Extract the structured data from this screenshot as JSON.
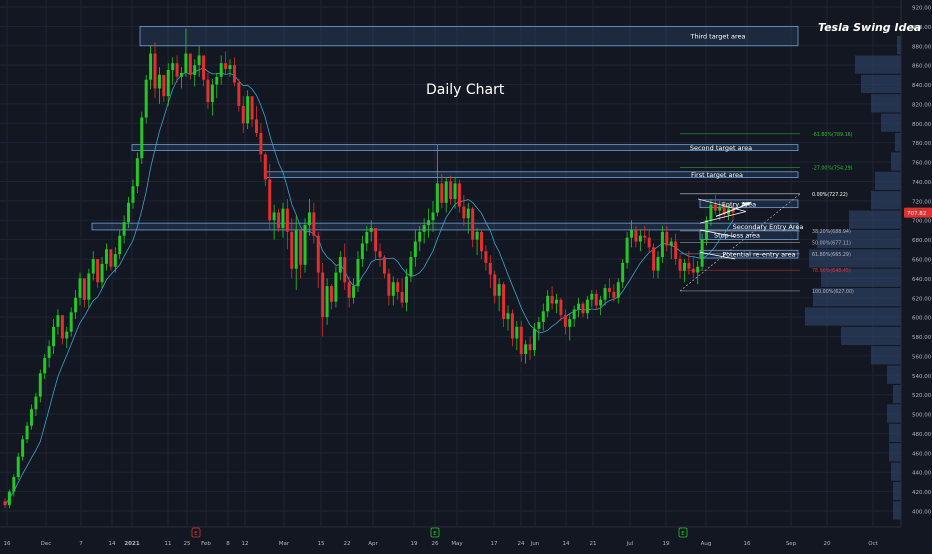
{
  "page": {
    "title": "Tesla Swing Idea",
    "subtitle": "Daily Chart",
    "last_price": "707.82",
    "colors": {
      "bg": "#131722",
      "up": "#26c626",
      "down": "#e03030",
      "ma": "#3ba4c9",
      "zone": "#4d7fb5",
      "grid": "#1f2433",
      "axis_text": "#b2b5be"
    }
  },
  "chart_data": {
    "type": "candlestick",
    "title": "Tesla Swing Idea",
    "subtitle": "Daily Chart",
    "ylim": [
      393,
      928
    ],
    "x_ticks": [
      "16",
      "Dec",
      "7",
      "14",
      "2021",
      "11",
      "25",
      "Feb",
      "8",
      "12",
      "Mar",
      "15",
      "22",
      "Apr",
      "19",
      "26",
      "May",
      "17",
      "24",
      "Jun",
      "14",
      "21",
      "Jul",
      "19",
      "Aug",
      "16",
      "Sep",
      "20",
      "Oct"
    ],
    "y_ticks": [
      920,
      900,
      880,
      860,
      840,
      820,
      800,
      780,
      760,
      740,
      720,
      700,
      680,
      660,
      640,
      620,
      600,
      580,
      560,
      540,
      520,
      500,
      480,
      460,
      440,
      420,
      400
    ],
    "last_price": 707.82,
    "zones": [
      {
        "label": "Third target area",
        "low": 880,
        "high": 900
      },
      {
        "label": "Second target area",
        "low": 772,
        "high": 778
      },
      {
        "label": "First target area",
        "low": 744,
        "high": 750
      },
      {
        "label": "Entry Area",
        "low": 713,
        "high": 721
      },
      {
        "label": "Secondary Entry Area",
        "low": 690,
        "high": 697
      },
      {
        "label": "Stop loss area",
        "low": 680,
        "high": 690
      },
      {
        "label": "Potential re-entry area",
        "low": 661,
        "high": 669
      }
    ],
    "fib_levels": [
      {
        "label": "-61.80%(789.16)",
        "value": 789.16,
        "color": "#26c626"
      },
      {
        "label": "-27.00%(754.29)",
        "value": 754.29,
        "color": "#26c626"
      },
      {
        "label": "0.00%(727.22)",
        "value": 727.22,
        "color": "#ffffff"
      },
      {
        "label": "38.20%(688.94)",
        "value": 688.94,
        "color": "#b2b5be"
      },
      {
        "label": "50.00%(677.11)",
        "value": 677.11,
        "color": "#b2b5be"
      },
      {
        "label": "61.80%(665.29)",
        "value": 665.29,
        "color": "#b2b5be"
      },
      {
        "label": "78.60%(648.45)",
        "value": 648.45,
        "color": "#e03030"
      },
      {
        "label": "100.00%(627.00)",
        "value": 627.0,
        "color": "#b2b5be"
      }
    ],
    "earnings_markers": [
      "E",
      "E",
      "E"
    ],
    "candles": [
      [
        410,
        413,
        403,
        406
      ],
      [
        406,
        422,
        403,
        420
      ],
      [
        420,
        438,
        415,
        435
      ],
      [
        435,
        460,
        432,
        456
      ],
      [
        456,
        478,
        452,
        474
      ],
      [
        474,
        492,
        470,
        488
      ],
      [
        488,
        510,
        484,
        505
      ],
      [
        505,
        522,
        498,
        518
      ],
      [
        518,
        546,
        512,
        542
      ],
      [
        542,
        562,
        536,
        558
      ],
      [
        558,
        576,
        548,
        570
      ],
      [
        570,
        598,
        562,
        590
      ],
      [
        590,
        608,
        582,
        602
      ],
      [
        602,
        596,
        572,
        578
      ],
      [
        578,
        590,
        568,
        585
      ],
      [
        585,
        610,
        580,
        605
      ],
      [
        605,
        628,
        598,
        620
      ],
      [
        620,
        646,
        612,
        640
      ],
      [
        640,
        632,
        610,
        618
      ],
      [
        618,
        650,
        610,
        645
      ],
      [
        645,
        668,
        638,
        660
      ],
      [
        660,
        652,
        630,
        636
      ],
      [
        636,
        662,
        630,
        655
      ],
      [
        655,
        676,
        648,
        670
      ],
      [
        670,
        664,
        648,
        652
      ],
      [
        652,
        672,
        646,
        665
      ],
      [
        665,
        690,
        660,
        684
      ],
      [
        684,
        705,
        676,
        698
      ],
      [
        698,
        724,
        692,
        718
      ],
      [
        718,
        742,
        712,
        735
      ],
      [
        735,
        770,
        728,
        764
      ],
      [
        764,
        812,
        758,
        806
      ],
      [
        806,
        850,
        800,
        845
      ],
      [
        845,
        880,
        835,
        872
      ],
      [
        872,
        884,
        826,
        836
      ],
      [
        836,
        858,
        820,
        850
      ],
      [
        850,
        846,
        822,
        828
      ],
      [
        828,
        862,
        818,
        855
      ],
      [
        855,
        868,
        840,
        862
      ],
      [
        862,
        870,
        842,
        848
      ],
      [
        848,
        858,
        836,
        852
      ],
      [
        852,
        898,
        848,
        872
      ],
      [
        872,
        868,
        845,
        850
      ],
      [
        850,
        866,
        838,
        860
      ],
      [
        860,
        880,
        848,
        870
      ],
      [
        870,
        860,
        838,
        845
      ],
      [
        845,
        852,
        815,
        822
      ],
      [
        822,
        846,
        808,
        840
      ],
      [
        840,
        852,
        826,
        848
      ],
      [
        848,
        870,
        840,
        862
      ],
      [
        862,
        874,
        850,
        856
      ],
      [
        856,
        866,
        848,
        860
      ],
      [
        860,
        868,
        838,
        842
      ],
      [
        842,
        846,
        812,
        818
      ],
      [
        818,
        828,
        790,
        800
      ],
      [
        800,
        834,
        794,
        828
      ],
      [
        828,
        822,
        796,
        804
      ],
      [
        804,
        818,
        786,
        790
      ],
      [
        790,
        800,
        760,
        768
      ],
      [
        768,
        770,
        735,
        742
      ],
      [
        742,
        758,
        690,
        700
      ],
      [
        700,
        716,
        680,
        708
      ],
      [
        708,
        712,
        688,
        692
      ],
      [
        692,
        718,
        682,
        712
      ],
      [
        712,
        722,
        670,
        688
      ],
      [
        688,
        702,
        640,
        650
      ],
      [
        650,
        704,
        628,
        690
      ],
      [
        690,
        684,
        640,
        654
      ],
      [
        654,
        702,
        646,
        695
      ],
      [
        695,
        722,
        684,
        708
      ],
      [
        708,
        718,
        676,
        684
      ],
      [
        684,
        688,
        630,
        646
      ],
      [
        646,
        656,
        580,
        600
      ],
      [
        600,
        640,
        592,
        632
      ],
      [
        632,
        634,
        608,
        616
      ],
      [
        616,
        652,
        610,
        646
      ],
      [
        646,
        668,
        638,
        662
      ],
      [
        662,
        676,
        628,
        636
      ],
      [
        636,
        642,
        610,
        620
      ],
      [
        620,
        640,
        614,
        632
      ],
      [
        632,
        668,
        626,
        660
      ],
      [
        660,
        684,
        652,
        676
      ],
      [
        676,
        694,
        668,
        688
      ],
      [
        688,
        700,
        678,
        692
      ],
      [
        692,
        684,
        660,
        668
      ],
      [
        668,
        676,
        652,
        662
      ],
      [
        662,
        664,
        640,
        645
      ],
      [
        645,
        650,
        612,
        622
      ],
      [
        622,
        642,
        612,
        636
      ],
      [
        636,
        640,
        618,
        626
      ],
      [
        626,
        640,
        610,
        615
      ],
      [
        615,
        650,
        606,
        642
      ],
      [
        642,
        668,
        636,
        662
      ],
      [
        662,
        690,
        652,
        678
      ],
      [
        678,
        694,
        668,
        688
      ],
      [
        688,
        702,
        676,
        695
      ],
      [
        695,
        712,
        682,
        700
      ],
      [
        700,
        720,
        688,
        708
      ],
      [
        708,
        778,
        704,
        738
      ],
      [
        738,
        748,
        712,
        718
      ],
      [
        718,
        744,
        708,
        740
      ],
      [
        740,
        746,
        716,
        722
      ],
      [
        722,
        744,
        712,
        738
      ],
      [
        738,
        742,
        708,
        714
      ],
      [
        714,
        726,
        694,
        702
      ],
      [
        702,
        718,
        686,
        712
      ],
      [
        712,
        714,
        672,
        680
      ],
      [
        680,
        692,
        664,
        688
      ],
      [
        688,
        690,
        660,
        668
      ],
      [
        668,
        674,
        648,
        656
      ],
      [
        656,
        664,
        630,
        644
      ],
      [
        644,
        648,
        614,
        622
      ],
      [
        622,
        640,
        606,
        634
      ],
      [
        634,
        636,
        590,
        598
      ],
      [
        598,
        612,
        586,
        604
      ],
      [
        604,
        608,
        570,
        578
      ],
      [
        578,
        596,
        566,
        590
      ],
      [
        590,
        596,
        554,
        562
      ],
      [
        562,
        576,
        552,
        572
      ],
      [
        572,
        580,
        556,
        566
      ],
      [
        566,
        594,
        560,
        588
      ],
      [
        588,
        600,
        576,
        595
      ],
      [
        595,
        614,
        586,
        606
      ],
      [
        606,
        628,
        600,
        622
      ],
      [
        622,
        632,
        608,
        614
      ],
      [
        614,
        624,
        604,
        618
      ],
      [
        618,
        620,
        596,
        602
      ],
      [
        602,
        608,
        582,
        590
      ],
      [
        590,
        604,
        576,
        598
      ],
      [
        598,
        612,
        590,
        608
      ],
      [
        608,
        620,
        600,
        614
      ],
      [
        614,
        616,
        600,
        604
      ],
      [
        604,
        622,
        598,
        618
      ],
      [
        618,
        628,
        610,
        624
      ],
      [
        624,
        628,
        608,
        612
      ],
      [
        612,
        622,
        602,
        618
      ],
      [
        618,
        634,
        612,
        630
      ],
      [
        630,
        640,
        620,
        626
      ],
      [
        626,
        634,
        616,
        620
      ],
      [
        620,
        640,
        614,
        636
      ],
      [
        636,
        660,
        630,
        656
      ],
      [
        656,
        688,
        650,
        682
      ],
      [
        682,
        700,
        672,
        690
      ],
      [
        690,
        694,
        672,
        678
      ],
      [
        678,
        690,
        668,
        684
      ],
      [
        684,
        694,
        676,
        682
      ],
      [
        682,
        690,
        666,
        672
      ],
      [
        672,
        676,
        640,
        648
      ],
      [
        648,
        668,
        640,
        662
      ],
      [
        662,
        694,
        656,
        688
      ],
      [
        688,
        694,
        668,
        674
      ],
      [
        674,
        682,
        660,
        678
      ],
      [
        678,
        686,
        654,
        660
      ],
      [
        660,
        664,
        640,
        648
      ],
      [
        648,
        660,
        636,
        656
      ],
      [
        656,
        668,
        644,
        650
      ],
      [
        650,
        662,
        640,
        646
      ],
      [
        646,
        658,
        634,
        652
      ],
      [
        652,
        686,
        648,
        680
      ],
      [
        680,
        704,
        674,
        700
      ],
      [
        700,
        722,
        694,
        716
      ],
      [
        716,
        726,
        706,
        710
      ],
      [
        710,
        720,
        700,
        714
      ],
      [
        714,
        718,
        702,
        706
      ],
      [
        706,
        716,
        700,
        712
      ],
      [
        712,
        716,
        700,
        708
      ]
    ]
  }
}
